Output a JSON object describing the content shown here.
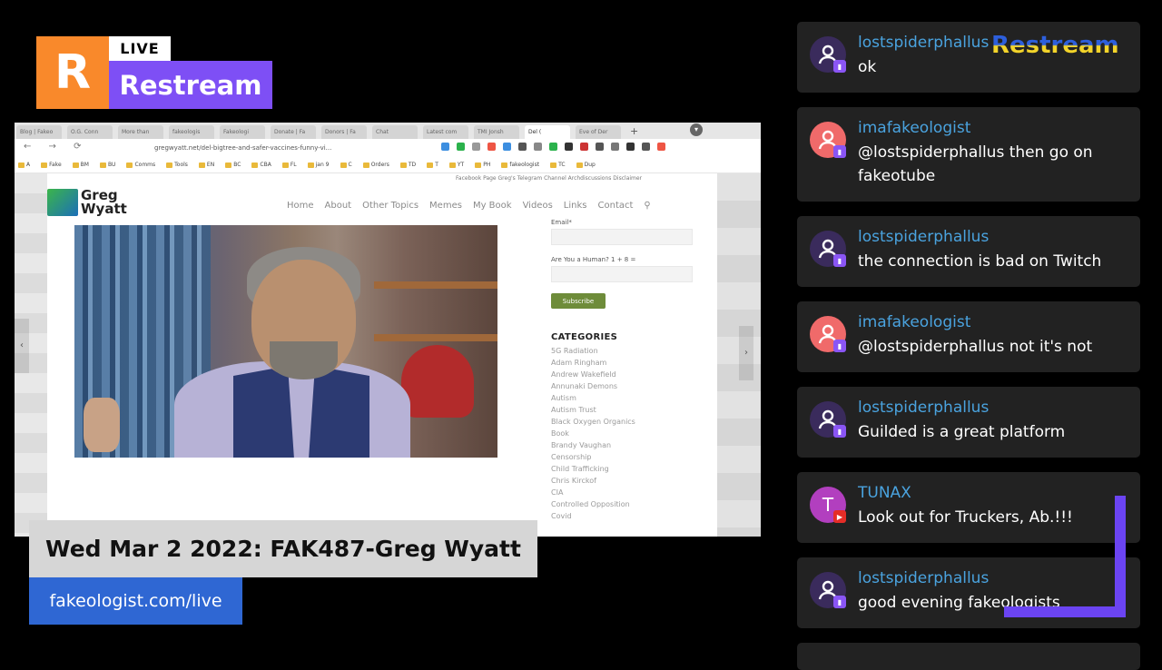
{
  "logo": {
    "letter": "R",
    "live": "LIVE",
    "name": "Restream"
  },
  "browser": {
    "tabs": [
      "Blog | Fakeo",
      "O.G. Conn",
      "More than",
      "fakeologis",
      "Fakeologi",
      "Donate | Fa",
      "Donors | Fa",
      "Chat",
      "Latest com",
      "TMI Jonsh",
      "Del (",
      "Eve of Der"
    ],
    "url": "gregwyatt.net/del-bigtree-and-safer-vaccines-funny-vi...",
    "bookmarks": [
      "A",
      "Fake",
      "BM",
      "BU",
      "Comms",
      "Tools",
      "EN",
      "BC",
      "CBA",
      "FL",
      "jan 9",
      "C",
      "Orders",
      "TD",
      "T",
      "YT",
      "PH",
      "fakeologist",
      "TC",
      "Dup"
    ],
    "site": {
      "topbar": "Facebook Page    Greg's Telegram Channel    Archdiscussions    Disclaimer",
      "logo_line1": "Greg",
      "logo_line2": "Wyatt",
      "nav": [
        "Home",
        "About",
        "Other Topics",
        "Memes",
        "My Book",
        "Videos",
        "Links",
        "Contact"
      ],
      "search_icon": "search-icon",
      "email_label": "Email*",
      "human_label": "Are You a Human? 1 + 8 =",
      "subscribe": "Subscribe",
      "categories_heading": "CATEGORIES",
      "categories": [
        "5G Radiation",
        "Adam Ringham",
        "Andrew Wakefield",
        "Annunaki Demons",
        "Autism",
        "Autism Trust",
        "Black Oxygen Organics",
        "Book",
        "Brandy Vaughan",
        "Censorship",
        "Child Trafficking",
        "Chris Kirckof",
        "CIA",
        "Controlled Opposition",
        "Covid"
      ]
    }
  },
  "lower_third": {
    "title": "Wed Mar 2 2022: FAK487-Greg Wyatt",
    "url": "fakeologist.com/live"
  },
  "watermark": "Restream",
  "chat": {
    "messages": [
      {
        "user": "lostspiderphallus",
        "text": "ok",
        "avatar": "user-icon",
        "avatar_color": "#3a2b5c",
        "platform": "twitch"
      },
      {
        "user": "imafakeologist",
        "text": "@lostspiderphallus then go on fakeotube",
        "avatar": "user-icon",
        "avatar_color": "#f06a6a",
        "platform": "twitch"
      },
      {
        "user": "lostspiderphallus",
        "text": "the connection is bad on Twitch",
        "avatar": "user-icon",
        "avatar_color": "#3a2b5c",
        "platform": "twitch"
      },
      {
        "user": "imafakeologist",
        "text": "@lostspiderphallus not it's not",
        "avatar": "user-icon",
        "avatar_color": "#f06a6a",
        "platform": "twitch"
      },
      {
        "user": "lostspiderphallus",
        "text": "Guilded is a great platform",
        "avatar": "user-icon",
        "avatar_color": "#3a2b5c",
        "platform": "twitch"
      },
      {
        "user": "TUNAX",
        "text": "Look out for Truckers, Ab.!!!",
        "avatar": "T",
        "avatar_color": "#b23fbf",
        "platform": "youtube"
      },
      {
        "user": "lostspiderphallus",
        "text": "good evening fakeologists",
        "avatar": "user-icon",
        "avatar_color": "#3a2b5c",
        "platform": "twitch"
      }
    ]
  },
  "colors": {
    "accent_orange": "#f9892b",
    "accent_purple": "#7e4ff5",
    "username_blue": "#4aa3df",
    "url_blue": "#2f67d3"
  }
}
